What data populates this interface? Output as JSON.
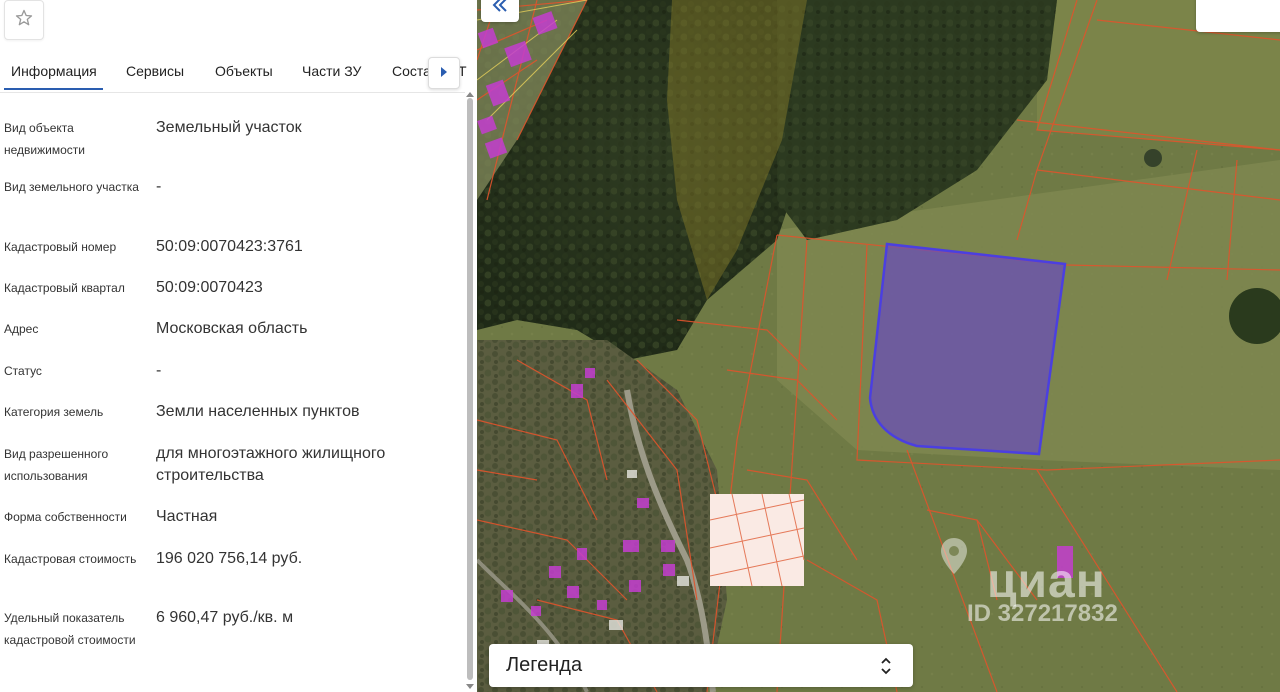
{
  "tabs": [
    "Информация",
    "Сервисы",
    "Объекты",
    "Части ЗУ",
    "Соста"
  ],
  "tab_overflow": "Т",
  "properties": [
    {
      "label": "Вид объекта недвижимости",
      "value": "Земельный участок"
    },
    {
      "label": "Вид земельного участка",
      "value": "-"
    },
    {
      "label": "Кадастровый номер",
      "value": "50:09:0070423:3761"
    },
    {
      "label": "Кадастровый квартал",
      "value": "50:09:0070423"
    },
    {
      "label": "Адрес",
      "value": "Московская область"
    },
    {
      "label": "Статус",
      "value": "-"
    },
    {
      "label": "Категория земель",
      "value": "Земли населенных пунктов"
    },
    {
      "label": "Вид разрешенного использования",
      "value": "для многоэтажного жилищного строительства"
    },
    {
      "label": "Форма собственности",
      "value": "Частная"
    },
    {
      "label": "Кадастровая стоимость",
      "value": "196 020 756,14 руб."
    },
    {
      "label": "Удельный показатель кадастровой стоимости",
      "value": "6 960,47 руб./кв. м"
    }
  ],
  "map": {
    "legend_label": "Легенда",
    "watermark_name": "циан",
    "watermark_id": "ID 327217832",
    "colors": {
      "parcel_fill": "#6a4fb8",
      "parcel_border": "#4b3fe0",
      "boundary": "#e0542c",
      "building": "#c43ed0"
    }
  },
  "icons": {
    "favorite": "star-icon",
    "tabs_next": "chevron-right-icon",
    "collapse": "double-chevron-left-icon",
    "legend_toggle": "chevron-up-down-icon"
  }
}
